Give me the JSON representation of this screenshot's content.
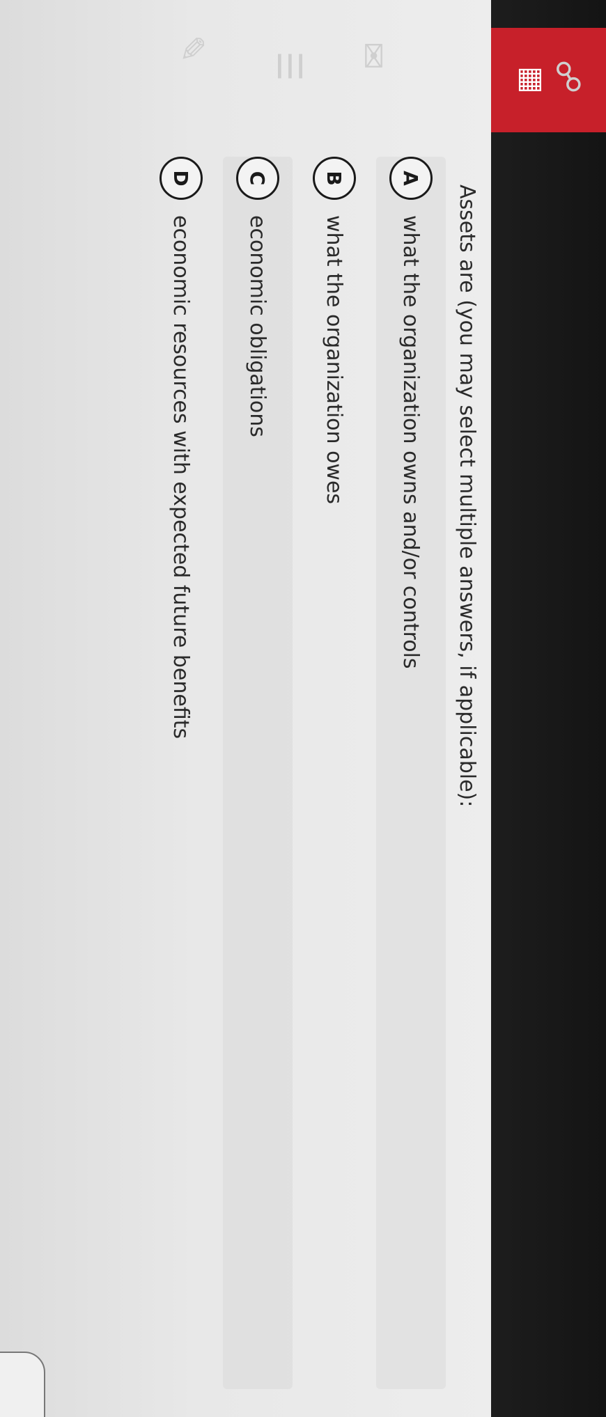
{
  "question": {
    "prompt": "Assets are (you may select multiple answers, if applicable):"
  },
  "options": [
    {
      "letter": "A",
      "text": "what the organization owns and/or controls"
    },
    {
      "letter": "B",
      "text": "what the organization owes"
    },
    {
      "letter": "C",
      "text": "economic obligations"
    },
    {
      "letter": "D",
      "text": "economic resources with expected future benefits"
    }
  ],
  "toolbar": {
    "icons": [
      "people-icon",
      "building-icon",
      "mail-icon",
      "checklist-icon",
      "pencil-icon"
    ],
    "active_tab_color": "#c7202a"
  }
}
